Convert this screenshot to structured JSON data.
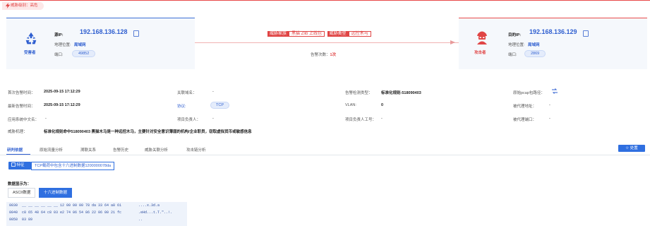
{
  "threat_level": {
    "label": "威胁级别：高危"
  },
  "attacker": {
    "role": "受害者",
    "ip_label": "源IP:",
    "ip": "192.168.136.128",
    "location_label": "地理位置:",
    "location": "局域网",
    "port_label": "端口:",
    "port": "49852"
  },
  "victim": {
    "role": "攻击者",
    "ip_label": "目的IP:",
    "ip": "192.168.136.129",
    "location_label": "地理位置:",
    "location": "局域网",
    "port_label": "端口:",
    "port": "2869"
  },
  "threat": {
    "family_label": "威胁家族",
    "family": "黑猫 Zlib 上线包",
    "type_label": "威胁类型",
    "type": "远控木马",
    "count_label": "告警次数：",
    "count": "1次"
  },
  "info": {
    "first_time_label": "首次告警时间：",
    "first_time": "2025-09-15 17:12:29",
    "last_time_label": "最新告警时间：",
    "last_time": "2025-09-15 17:12:29",
    "app_name_label": "应用系统中文名：",
    "app_name": "-",
    "domain_label": "关联域名：",
    "domain": "-",
    "protocol_label": "协议:",
    "protocol": "TCP",
    "owner_label": "项目负责人：",
    "owner": "-",
    "detect_label": "告警检测类型：",
    "detect": "标准化规则-518090403",
    "vlan_label": "VLAN:",
    "vlan": "0",
    "owner_id_label": "项目负责人工号：",
    "owner_id": "-",
    "pcap_label": "原始pcap包路径：",
    "proxy_addr_label": "被代理地址：",
    "proxy_addr": "-",
    "proxy_port_label": "被代理端口：",
    "proxy_port": "-",
    "desc_label": "威胁机理：",
    "desc": "标准化规则命中518090403 黑猫木马是一种远控木马，主要针对安全意识薄弱的机构/企业职员，窃取虚拟货币或敏感信息"
  },
  "tabs": [
    "研判依据",
    "原始流量分析",
    "溯联关系",
    "告警历史",
    "威胁关联分析",
    "攻击链分析"
  ],
  "dispose_button": "处置",
  "feature": {
    "button": "特征",
    "text": "TCP载荷中包含十六进制数据1200000078da"
  },
  "display": {
    "label": "数据显示为：",
    "ascii": "ASCII数据",
    "hex": "十六进制数据"
  },
  "hex_rows": [
    {
      "offset": "0030",
      "bytes": "__ __ __ __ __ __ 12 00 00 00 78 da 33 64 a8 61",
      "ascii": "....x.3d.a"
    },
    {
      "offset": "0040",
      "bytes": "c8 65 48 64 c8 03 e2 74 06 54 86 22 06 00 21 fc",
      "ascii": ".eHd...t.T.\"..!."
    },
    {
      "offset": "0050",
      "bytes": "03 89",
      "ascii": ".."
    }
  ],
  "colors": {
    "accent": "#2f6fe0",
    "danger": "#e04545"
  }
}
